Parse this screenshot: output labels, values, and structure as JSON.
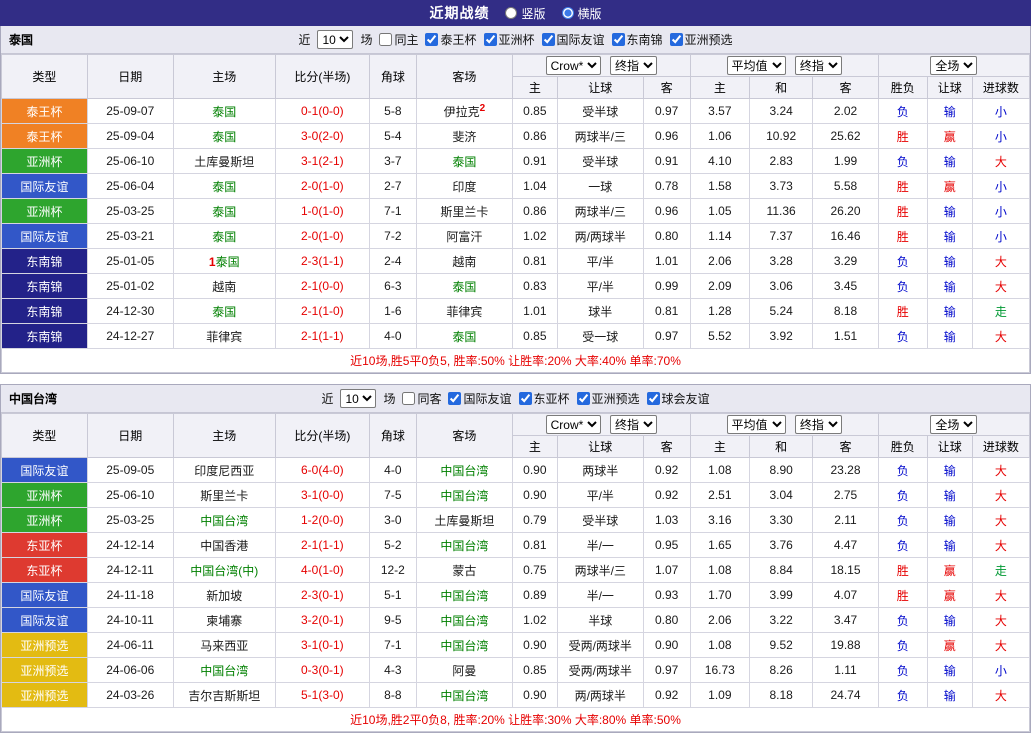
{
  "topbar": {
    "title": "近期战绩",
    "layout_options": [
      {
        "label": "竖版",
        "checked": false
      },
      {
        "label": "横版",
        "checked": true
      }
    ]
  },
  "filter_labels": {
    "near": "近",
    "games": "场"
  },
  "table_header": {
    "type": "类型",
    "date": "日期",
    "home": "主场",
    "score": "比分(半场)",
    "corner": "角球",
    "away": "客场",
    "odds_select_a": "Crow*",
    "odds_select_b": "终指",
    "avg_select_a": "平均值",
    "avg_select_b": "终指",
    "full_select": "全场",
    "odds_home": "主",
    "odds_handicap": "让球",
    "odds_away": "客",
    "avg_home": "主",
    "avg_draw": "和",
    "avg_away": "客",
    "win_lose": "胜负",
    "handicap": "让球",
    "goals": "进球数"
  },
  "sections": [
    {
      "team": "泰国",
      "filter": {
        "count": "10",
        "same": "同主",
        "same_checked": false,
        "competitions": [
          "泰王杯",
          "亚洲杯",
          "国际友谊",
          "东南锦",
          "亚洲预选"
        ]
      },
      "rows": [
        {
          "comp": "泰王杯",
          "comp_color": "orange",
          "date": "25-09-07",
          "home": "泰国",
          "home_focus": true,
          "home_mark": "",
          "score": "0-1(0-0)",
          "corner": "5-8",
          "away": "伊拉克",
          "away_focus": false,
          "away_mark": "2",
          "odds_home": "0.85",
          "handicap_line": "受半球",
          "odds_away": "0.97",
          "avg_home": "3.57",
          "avg_draw": "3.24",
          "avg_away": "2.02",
          "result": "负",
          "result_color": "blue",
          "let_result": "输",
          "let_color": "blue",
          "goals": "小",
          "goals_color": "blue"
        },
        {
          "comp": "泰王杯",
          "comp_color": "orange",
          "date": "25-09-04",
          "home": "泰国",
          "home_focus": true,
          "home_mark": "",
          "score": "3-0(2-0)",
          "corner": "5-4",
          "away": "斐济",
          "away_focus": false,
          "away_mark": "",
          "odds_home": "0.86",
          "handicap_line": "两球半/三",
          "odds_away": "0.96",
          "avg_home": "1.06",
          "avg_draw": "10.92",
          "avg_away": "25.62",
          "result": "胜",
          "result_color": "red",
          "let_result": "赢",
          "let_color": "red",
          "goals": "小",
          "goals_color": "blue"
        },
        {
          "comp": "亚洲杯",
          "comp_color": "green",
          "date": "25-06-10",
          "home": "土库曼斯坦",
          "home_focus": false,
          "home_mark": "",
          "score": "3-1(2-1)",
          "corner": "3-7",
          "away": "泰国",
          "away_focus": true,
          "away_mark": "",
          "odds_home": "0.91",
          "handicap_line": "受半球",
          "odds_away": "0.91",
          "avg_home": "4.10",
          "avg_draw": "2.83",
          "avg_away": "1.99",
          "result": "负",
          "result_color": "blue",
          "let_result": "输",
          "let_color": "blue",
          "goals": "大",
          "goals_color": "red"
        },
        {
          "comp": "国际友谊",
          "comp_color": "blue",
          "date": "25-06-04",
          "home": "泰国",
          "home_focus": true,
          "home_mark": "",
          "score": "2-0(1-0)",
          "corner": "2-7",
          "away": "印度",
          "away_focus": false,
          "away_mark": "",
          "odds_home": "1.04",
          "handicap_line": "一球",
          "odds_away": "0.78",
          "avg_home": "1.58",
          "avg_draw": "3.73",
          "avg_away": "5.58",
          "result": "胜",
          "result_color": "red",
          "let_result": "赢",
          "let_color": "red",
          "goals": "小",
          "goals_color": "blue"
        },
        {
          "comp": "亚洲杯",
          "comp_color": "green",
          "date": "25-03-25",
          "home": "泰国",
          "home_focus": true,
          "home_mark": "",
          "score": "1-0(1-0)",
          "corner": "7-1",
          "away": "斯里兰卡",
          "away_focus": false,
          "away_mark": "",
          "odds_home": "0.86",
          "handicap_line": "两球半/三",
          "odds_away": "0.96",
          "avg_home": "1.05",
          "avg_draw": "11.36",
          "avg_away": "26.20",
          "result": "胜",
          "result_color": "red",
          "let_result": "输",
          "let_color": "blue",
          "goals": "小",
          "goals_color": "blue"
        },
        {
          "comp": "国际友谊",
          "comp_color": "blue",
          "date": "25-03-21",
          "home": "泰国",
          "home_focus": true,
          "home_mark": "",
          "score": "2-0(1-0)",
          "corner": "7-2",
          "away": "阿富汗",
          "away_focus": false,
          "away_mark": "",
          "odds_home": "1.02",
          "handicap_line": "两/两球半",
          "odds_away": "0.80",
          "avg_home": "1.14",
          "avg_draw": "7.37",
          "avg_away": "16.46",
          "result": "胜",
          "result_color": "red",
          "let_result": "输",
          "let_color": "blue",
          "goals": "小",
          "goals_color": "blue"
        },
        {
          "comp": "东南锦",
          "comp_color": "navy",
          "date": "25-01-05",
          "home": "泰国",
          "home_focus": true,
          "home_mark": "1",
          "score": "2-3(1-1)",
          "corner": "2-4",
          "away": "越南",
          "away_focus": false,
          "away_mark": "",
          "odds_home": "0.81",
          "handicap_line": "平/半",
          "odds_away": "1.01",
          "avg_home": "2.06",
          "avg_draw": "3.28",
          "avg_away": "3.29",
          "result": "负",
          "result_color": "blue",
          "let_result": "输",
          "let_color": "blue",
          "goals": "大",
          "goals_color": "red"
        },
        {
          "comp": "东南锦",
          "comp_color": "navy",
          "date": "25-01-02",
          "home": "越南",
          "home_focus": false,
          "home_mark": "",
          "score": "2-1(0-0)",
          "corner": "6-3",
          "away": "泰国",
          "away_focus": true,
          "away_mark": "",
          "odds_home": "0.83",
          "handicap_line": "平/半",
          "odds_away": "0.99",
          "avg_home": "2.09",
          "avg_draw": "3.06",
          "avg_away": "3.45",
          "result": "负",
          "result_color": "blue",
          "let_result": "输",
          "let_color": "blue",
          "goals": "大",
          "goals_color": "red"
        },
        {
          "comp": "东南锦",
          "comp_color": "navy",
          "date": "24-12-30",
          "home": "泰国",
          "home_focus": true,
          "home_mark": "",
          "score": "2-1(1-0)",
          "corner": "1-6",
          "away": "菲律宾",
          "away_focus": false,
          "away_mark": "",
          "odds_home": "1.01",
          "handicap_line": "球半",
          "odds_away": "0.81",
          "avg_home": "1.28",
          "avg_draw": "5.24",
          "avg_away": "8.18",
          "result": "胜",
          "result_color": "red",
          "let_result": "输",
          "let_color": "blue",
          "goals": "走",
          "goals_color": "green"
        },
        {
          "comp": "东南锦",
          "comp_color": "navy",
          "date": "24-12-27",
          "home": "菲律宾",
          "home_focus": false,
          "home_mark": "",
          "score": "2-1(1-1)",
          "corner": "4-0",
          "away": "泰国",
          "away_focus": true,
          "away_mark": "",
          "odds_home": "0.85",
          "handicap_line": "受一球",
          "odds_away": "0.97",
          "avg_home": "5.52",
          "avg_draw": "3.92",
          "avg_away": "1.51",
          "result": "负",
          "result_color": "blue",
          "let_result": "输",
          "let_color": "blue",
          "goals": "大",
          "goals_color": "red"
        }
      ],
      "summary": "近10场,胜5平0负5, 胜率:50% 让胜率:20% 大率:40% 单率:70%"
    },
    {
      "team": "中国台湾",
      "filter": {
        "count": "10",
        "same": "同客",
        "same_checked": false,
        "competitions": [
          "国际友谊",
          "东亚杯",
          "亚洲预选",
          "球会友谊"
        ]
      },
      "rows": [
        {
          "comp": "国际友谊",
          "comp_color": "blue",
          "date": "25-09-05",
          "home": "印度尼西亚",
          "home_focus": false,
          "home_mark": "",
          "score": "6-0(4-0)",
          "corner": "4-0",
          "away": "中国台湾",
          "away_focus": true,
          "away_mark": "",
          "odds_home": "0.90",
          "handicap_line": "两球半",
          "odds_away": "0.92",
          "avg_home": "1.08",
          "avg_draw": "8.90",
          "avg_away": "23.28",
          "result": "负",
          "result_color": "blue",
          "let_result": "输",
          "let_color": "blue",
          "goals": "大",
          "goals_color": "red"
        },
        {
          "comp": "亚洲杯",
          "comp_color": "green",
          "date": "25-06-10",
          "home": "斯里兰卡",
          "home_focus": false,
          "home_mark": "",
          "score": "3-1(0-0)",
          "corner": "7-5",
          "away": "中国台湾",
          "away_focus": true,
          "away_mark": "",
          "odds_home": "0.90",
          "handicap_line": "平/半",
          "odds_away": "0.92",
          "avg_home": "2.51",
          "avg_draw": "3.04",
          "avg_away": "2.75",
          "result": "负",
          "result_color": "blue",
          "let_result": "输",
          "let_color": "blue",
          "goals": "大",
          "goals_color": "red"
        },
        {
          "comp": "亚洲杯",
          "comp_color": "green",
          "date": "25-03-25",
          "home": "中国台湾",
          "home_focus": true,
          "home_mark": "",
          "score": "1-2(0-0)",
          "corner": "3-0",
          "away": "土库曼斯坦",
          "away_focus": false,
          "away_mark": "",
          "odds_home": "0.79",
          "handicap_line": "受半球",
          "odds_away": "1.03",
          "avg_home": "3.16",
          "avg_draw": "3.30",
          "avg_away": "2.11",
          "result": "负",
          "result_color": "blue",
          "let_result": "输",
          "let_color": "blue",
          "goals": "大",
          "goals_color": "red"
        },
        {
          "comp": "东亚杯",
          "comp_color": "red",
          "date": "24-12-14",
          "home": "中国香港",
          "home_focus": false,
          "home_mark": "",
          "score": "2-1(1-1)",
          "corner": "5-2",
          "away": "中国台湾",
          "away_focus": true,
          "away_mark": "",
          "odds_home": "0.81",
          "handicap_line": "半/一",
          "odds_away": "0.95",
          "avg_home": "1.65",
          "avg_draw": "3.76",
          "avg_away": "4.47",
          "result": "负",
          "result_color": "blue",
          "let_result": "输",
          "let_color": "blue",
          "goals": "大",
          "goals_color": "red"
        },
        {
          "comp": "东亚杯",
          "comp_color": "red",
          "date": "24-12-11",
          "home": "中国台湾(中)",
          "home_focus": true,
          "home_mark": "",
          "score": "4-0(1-0)",
          "corner": "12-2",
          "away": "蒙古",
          "away_focus": false,
          "away_mark": "",
          "odds_home": "0.75",
          "handicap_line": "两球半/三",
          "odds_away": "1.07",
          "avg_home": "1.08",
          "avg_draw": "8.84",
          "avg_away": "18.15",
          "result": "胜",
          "result_color": "red",
          "let_result": "赢",
          "let_color": "red",
          "goals": "走",
          "goals_color": "green"
        },
        {
          "comp": "国际友谊",
          "comp_color": "blue",
          "date": "24-11-18",
          "home": "新加坡",
          "home_focus": false,
          "home_mark": "",
          "score": "2-3(0-1)",
          "corner": "5-1",
          "away": "中国台湾",
          "away_focus": true,
          "away_mark": "",
          "odds_home": "0.89",
          "handicap_line": "半/一",
          "odds_away": "0.93",
          "avg_home": "1.70",
          "avg_draw": "3.99",
          "avg_away": "4.07",
          "result": "胜",
          "result_color": "red",
          "let_result": "赢",
          "let_color": "red",
          "goals": "大",
          "goals_color": "red"
        },
        {
          "comp": "国际友谊",
          "comp_color": "blue",
          "date": "24-10-11",
          "home": "柬埔寨",
          "home_focus": false,
          "home_mark": "",
          "score": "3-2(0-1)",
          "corner": "9-5",
          "away": "中国台湾",
          "away_focus": true,
          "away_mark": "",
          "odds_home": "1.02",
          "handicap_line": "半球",
          "odds_away": "0.80",
          "avg_home": "2.06",
          "avg_draw": "3.22",
          "avg_away": "3.47",
          "result": "负",
          "result_color": "blue",
          "let_result": "输",
          "let_color": "blue",
          "goals": "大",
          "goals_color": "red"
        },
        {
          "comp": "亚洲预选",
          "comp_color": "yellow",
          "date": "24-06-11",
          "home": "马来西亚",
          "home_focus": false,
          "home_mark": "",
          "score": "3-1(0-1)",
          "corner": "7-1",
          "away": "中国台湾",
          "away_focus": true,
          "away_mark": "",
          "odds_home": "0.90",
          "handicap_line": "受两/两球半",
          "odds_away": "0.90",
          "avg_home": "1.08",
          "avg_draw": "9.52",
          "avg_away": "19.88",
          "result": "负",
          "result_color": "blue",
          "let_result": "赢",
          "let_color": "red",
          "goals": "大",
          "goals_color": "red"
        },
        {
          "comp": "亚洲预选",
          "comp_color": "yellow",
          "date": "24-06-06",
          "home": "中国台湾",
          "home_focus": true,
          "home_mark": "",
          "score": "0-3(0-1)",
          "corner": "4-3",
          "away": "阿曼",
          "away_focus": false,
          "away_mark": "",
          "odds_home": "0.85",
          "handicap_line": "受两/两球半",
          "odds_away": "0.97",
          "avg_home": "16.73",
          "avg_draw": "8.26",
          "avg_away": "1.11",
          "result": "负",
          "result_color": "blue",
          "let_result": "输",
          "let_color": "blue",
          "goals": "小",
          "goals_color": "blue"
        },
        {
          "comp": "亚洲预选",
          "comp_color": "yellow",
          "date": "24-03-26",
          "home": "吉尔吉斯斯坦",
          "home_focus": false,
          "home_mark": "",
          "score": "5-1(3-0)",
          "corner": "8-8",
          "away": "中国台湾",
          "away_focus": true,
          "away_mark": "",
          "odds_home": "0.90",
          "handicap_line": "两/两球半",
          "odds_away": "0.92",
          "avg_home": "1.09",
          "avg_draw": "8.18",
          "avg_away": "24.74",
          "result": "负",
          "result_color": "blue",
          "let_result": "输",
          "let_color": "blue",
          "goals": "大",
          "goals_color": "red"
        }
      ],
      "summary": "近10场,胜2平0负8, 胜率:20% 让胜率:30% 大率:80% 单率:50%"
    }
  ]
}
